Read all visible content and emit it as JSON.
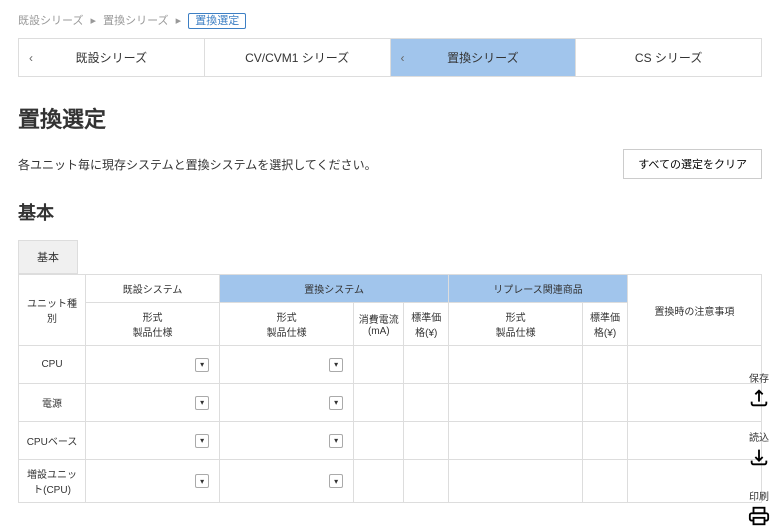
{
  "breadcrumb": {
    "item1": "既設シリーズ",
    "item2": "置換シリーズ",
    "current": "置換選定"
  },
  "nav": {
    "tabs": [
      {
        "label": "既設シリーズ",
        "chev": "‹"
      },
      {
        "label": "CV/CVM1 シリーズ",
        "chev": ""
      },
      {
        "label": "置換シリーズ",
        "chev": "‹"
      },
      {
        "label": "CS シリーズ",
        "chev": ""
      }
    ]
  },
  "page": {
    "title": "置換選定",
    "subtitle": "各ユニット毎に現存システムと置換システムを選択してください。",
    "clear": "すべての選定をクリア"
  },
  "section": {
    "title": "基本",
    "subtab": "基本"
  },
  "table": {
    "group_unit": "ユニット種別",
    "group_existing": "既設システム",
    "group_replace": "置換システム",
    "group_related": "リプレース関連商品",
    "group_notes": "置換時の注意事項",
    "col_type": "形式",
    "col_spec": "製品仕様",
    "col_curr": "消費電流(mA)",
    "col_price": "標準価格(¥)",
    "rows": [
      {
        "name": "CPU"
      },
      {
        "name": "電源"
      },
      {
        "name": "CPUベース"
      },
      {
        "name": "増設ユニット(CPU)"
      }
    ]
  },
  "side": {
    "save": "保存",
    "load": "読込",
    "print": "印刷"
  }
}
